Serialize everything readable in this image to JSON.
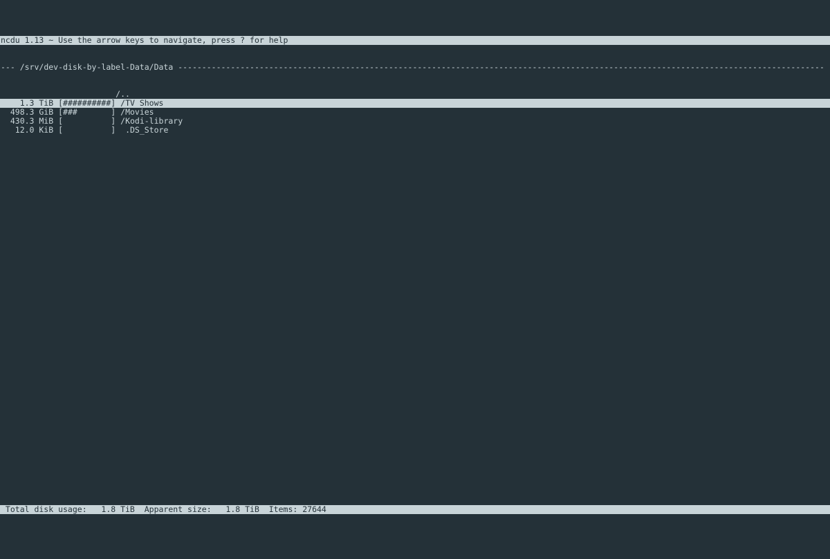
{
  "header": {
    "text": "ncdu 1.13 ~ Use the arrow keys to navigate, press ? for help"
  },
  "path": {
    "prefix": "--- ",
    "dir": "/srv/dev-disk-by-label-Data/Data",
    "dashfill": " "
  },
  "rows": [
    {
      "size": "         ",
      "bar": "            ",
      "name": "/..",
      "selected": false,
      "parent": true
    },
    {
      "size": "    1.3 TiB",
      "bar": "[##########]",
      "name": "/TV Shows",
      "selected": true
    },
    {
      "size": "  498.3 GiB",
      "bar": "[###       ]",
      "name": "/Movies",
      "selected": false
    },
    {
      "size": "  430.3 MiB",
      "bar": "[          ]",
      "name": "/Kodi-library",
      "selected": false
    },
    {
      "size": "   12.0 KiB",
      "bar": "[          ]",
      "name": " .DS_Store",
      "selected": false
    }
  ],
  "footer": {
    "total_label": " Total disk usage:",
    "total_value": "   1.8 TiB",
    "apparent_label": "  Apparent size:",
    "apparent_value": "   1.8 TiB",
    "items_label": "  Items:",
    "items_value": " 27644"
  }
}
